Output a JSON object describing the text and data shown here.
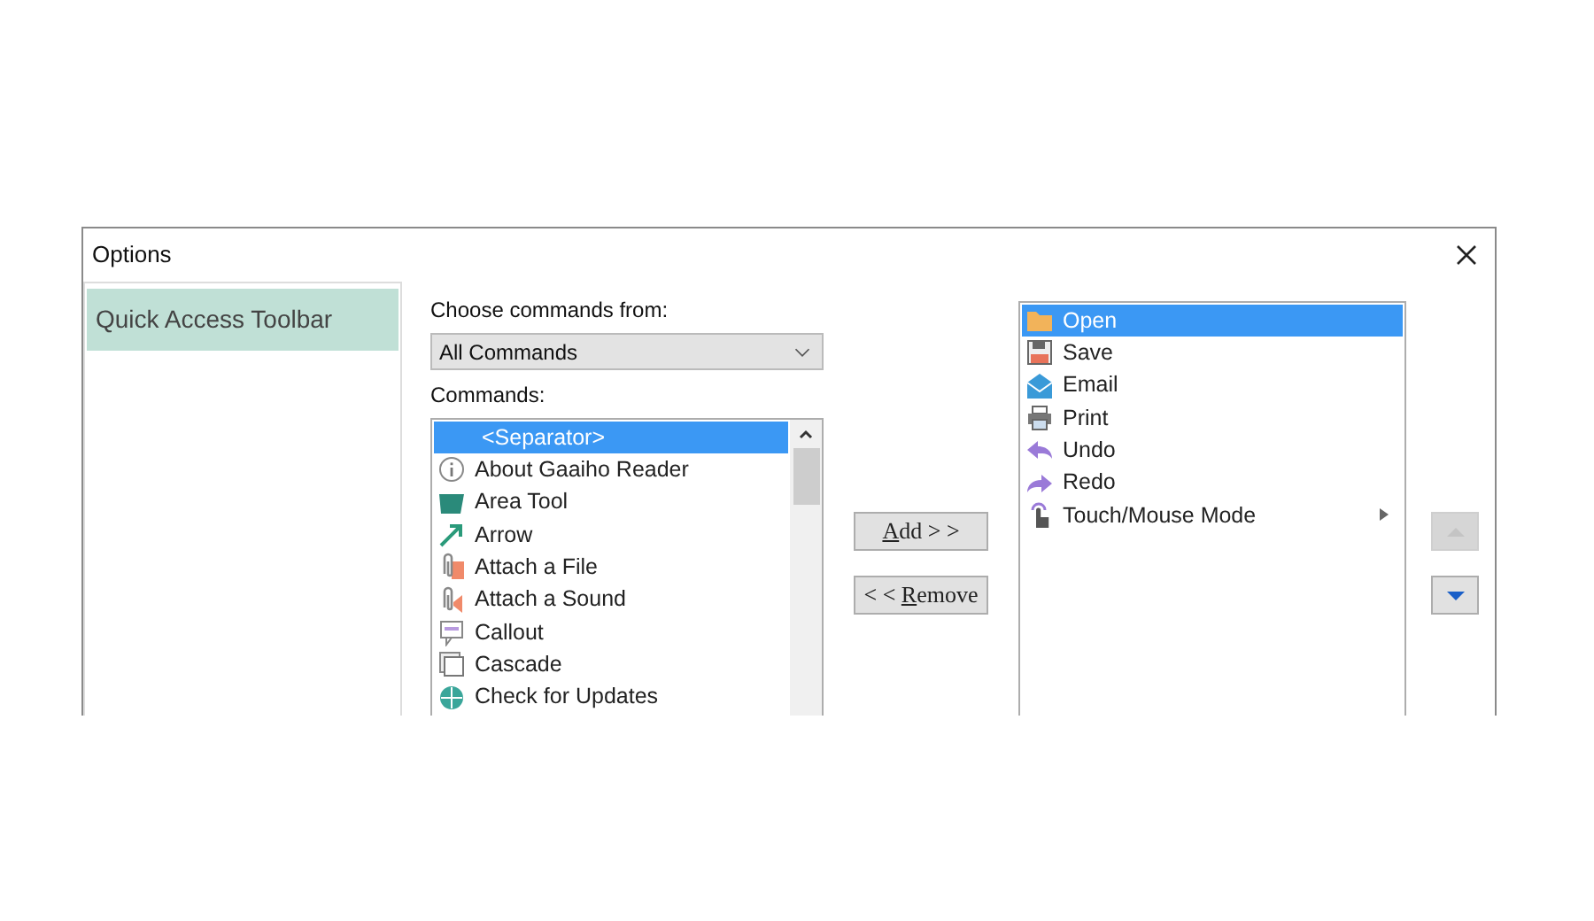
{
  "window": {
    "title": "Options"
  },
  "sidebar": {
    "items": [
      {
        "label": "Quick Access Toolbar",
        "selected": true
      }
    ]
  },
  "choose": {
    "label": "Choose commands from:",
    "value": "All Commands"
  },
  "commands": {
    "label": "Commands:",
    "items": [
      {
        "label": "<Separator>",
        "selected": true
      },
      {
        "label": "About Gaaiho Reader",
        "selected": false
      },
      {
        "label": "Area Tool",
        "selected": false
      },
      {
        "label": "Arrow",
        "selected": false
      },
      {
        "label": "Attach a File",
        "selected": false
      },
      {
        "label": "Attach a Sound",
        "selected": false
      },
      {
        "label": "Callout",
        "selected": false
      },
      {
        "label": "Cascade",
        "selected": false
      },
      {
        "label": "Check for Updates",
        "selected": false
      }
    ]
  },
  "add_button": {
    "access_key": "A",
    "suffix": "dd > >"
  },
  "remove_button": {
    "prefix": "< < ",
    "access_key": "R",
    "suffix": "emove"
  },
  "toolbar": {
    "items": [
      {
        "label": "Open",
        "selected": true,
        "has_submenu": false
      },
      {
        "label": "Save",
        "selected": false,
        "has_submenu": false
      },
      {
        "label": "Email",
        "selected": false,
        "has_submenu": false
      },
      {
        "label": "Print",
        "selected": false,
        "has_submenu": false
      },
      {
        "label": "Undo",
        "selected": false,
        "has_submenu": false
      },
      {
        "label": "Redo",
        "selected": false,
        "has_submenu": false
      },
      {
        "label": "Touch/Mouse Mode",
        "selected": false,
        "has_submenu": true
      }
    ]
  },
  "move_up": {
    "disabled": true
  },
  "move_down": {
    "disabled": false
  }
}
